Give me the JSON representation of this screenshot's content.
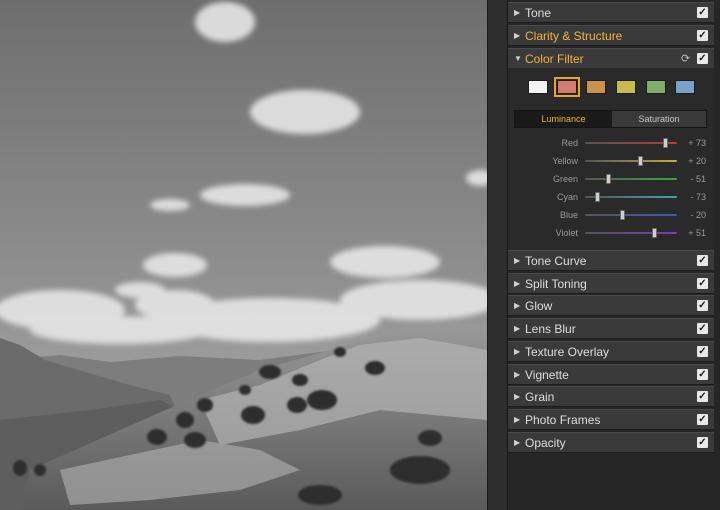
{
  "photo": {
    "description_icon": "landscape-photo"
  },
  "panel": {
    "sections_top": [
      {
        "label": "Tone",
        "checked": true
      },
      {
        "label": "Clarity & Structure",
        "checked": true,
        "accent": true
      }
    ],
    "color_filter": {
      "label": "Color Filter",
      "checked": true,
      "reset_icon": "refresh-icon",
      "swatches": [
        {
          "name": "white",
          "color": "#f2f2f2"
        },
        {
          "name": "red",
          "color": "#d47a72",
          "selected": true
        },
        {
          "name": "orange",
          "color": "#c9924e"
        },
        {
          "name": "yellow",
          "color": "#c7bb4e"
        },
        {
          "name": "green",
          "color": "#7fae6a"
        },
        {
          "name": "blue",
          "color": "#7aa2c9"
        }
      ],
      "tabs": {
        "active": "Luminance",
        "inactive": "Saturation"
      },
      "sliders": [
        {
          "label": "Red",
          "value": "+ 73",
          "level": 73,
          "track": "#b83a3a"
        },
        {
          "label": "Yellow",
          "value": "+ 20",
          "level": 20,
          "track": "#b8b23a"
        },
        {
          "label": "Green",
          "value": "- 51",
          "level": -51,
          "track": "#3aa83a"
        },
        {
          "label": "Cyan",
          "value": "- 73",
          "level": -73,
          "track": "#3aa8a8"
        },
        {
          "label": "Blue",
          "value": "- 20",
          "level": -20,
          "track": "#3a5ab8"
        },
        {
          "label": "Violet",
          "value": "+ 51",
          "level": 51,
          "track": "#7a3ab8"
        }
      ]
    },
    "sections_bottom": [
      {
        "label": "Tone Curve",
        "checked": true
      },
      {
        "label": "Split Toning",
        "checked": true
      },
      {
        "label": "Glow",
        "checked": true
      },
      {
        "label": "Lens Blur",
        "checked": true
      },
      {
        "label": "Texture Overlay",
        "checked": true
      },
      {
        "label": "Vignette",
        "checked": true
      },
      {
        "label": "Grain",
        "checked": true
      },
      {
        "label": "Photo Frames",
        "checked": true
      },
      {
        "label": "Opacity",
        "checked": true
      }
    ],
    "check_glyph": "✓",
    "arrow_collapsed": "▶",
    "arrow_expanded": "▼"
  }
}
